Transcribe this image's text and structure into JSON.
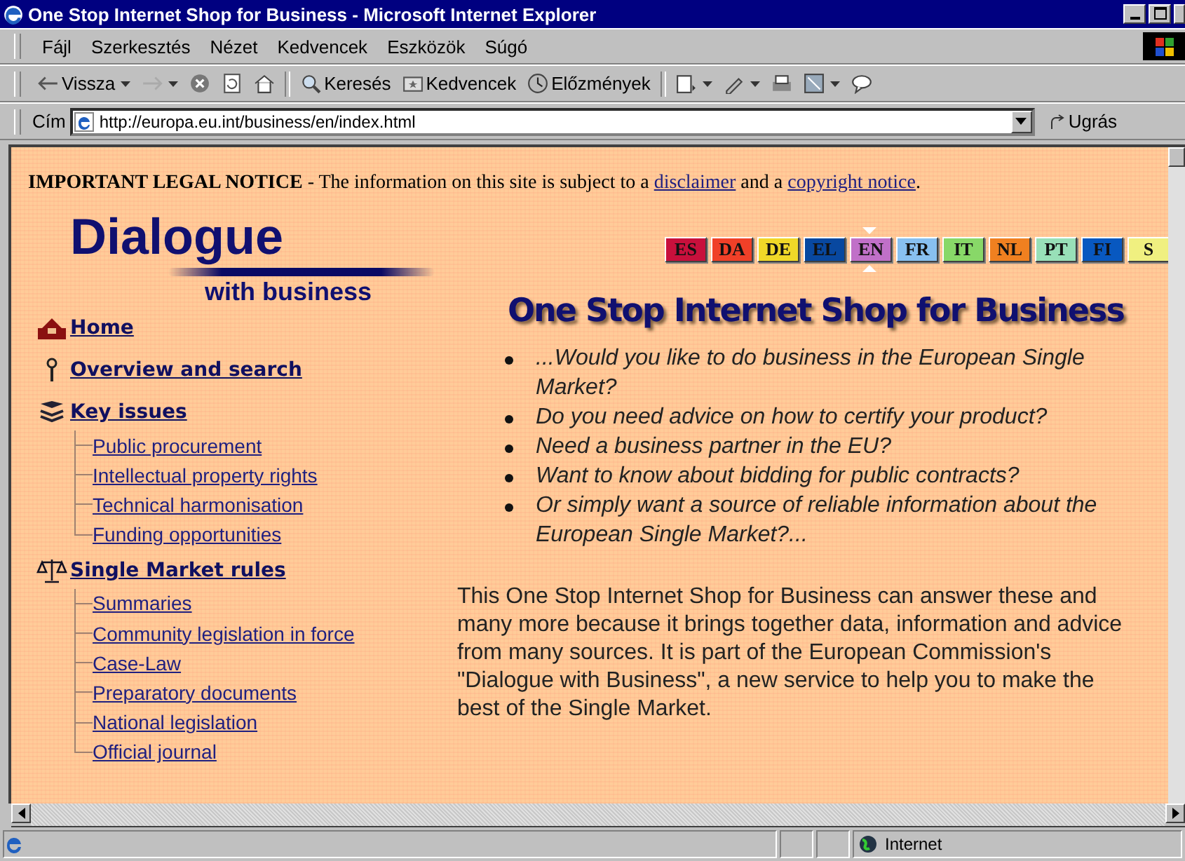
{
  "window": {
    "title": "One Stop Internet Shop for Business - Microsoft Internet Explorer"
  },
  "menu": [
    "Fájl",
    "Szerkesztés",
    "Nézet",
    "Kedvencek",
    "Eszközök",
    "Súgó"
  ],
  "toolbar": [
    {
      "kind": "back",
      "label": "Vissza"
    },
    {
      "kind": "forward"
    },
    {
      "kind": "stop"
    },
    {
      "kind": "refresh"
    },
    {
      "kind": "home"
    },
    {
      "kind": "search",
      "label": "Keresés"
    },
    {
      "kind": "favorites",
      "label": "Kedvencek"
    },
    {
      "kind": "history",
      "label": "Előzmények"
    },
    {
      "kind": "mail"
    },
    {
      "kind": "edit"
    },
    {
      "kind": "print"
    },
    {
      "kind": "discuss"
    },
    {
      "kind": "messenger"
    }
  ],
  "address": {
    "label": "Cím",
    "value": "http://europa.eu.int/business/en/index.html",
    "go": "Ugrás"
  },
  "notice": {
    "heading": "IMPORTANT LEGAL NOTICE",
    "text": " - The information on this site is subject to a ",
    "link1": "disclaimer",
    "mid": " and a ",
    "link2": "copyright notice",
    "end": "."
  },
  "logo": {
    "title": "Dialogue",
    "subtitle": "with business"
  },
  "languages": [
    {
      "code": "ES",
      "color": "#c8103c",
      "selected": false
    },
    {
      "code": "DA",
      "color": "#f04028",
      "selected": false
    },
    {
      "code": "DE",
      "color": "#f0d828",
      "selected": false
    },
    {
      "code": "EL",
      "color": "#0848a0",
      "selected": false
    },
    {
      "code": "EN",
      "color": "#c070c8",
      "selected": true
    },
    {
      "code": "FR",
      "color": "#88c0f0",
      "selected": false
    },
    {
      "code": "IT",
      "color": "#88d868",
      "selected": false
    },
    {
      "code": "NL",
      "color": "#f08020",
      "selected": false
    },
    {
      "code": "PT",
      "color": "#98e0b8",
      "selected": false
    },
    {
      "code": "FI",
      "color": "#0858c0",
      "selected": false
    },
    {
      "code": "S",
      "color": "#f0f080",
      "selected": false
    }
  ],
  "nav": [
    {
      "kind": "home",
      "label": "Home"
    },
    {
      "kind": "pin",
      "label": "Overview and search"
    },
    {
      "kind": "books",
      "label": "Key issues",
      "children": [
        "Public procurement",
        "Intellectual property rights",
        "Technical harmonisation",
        "Funding opportunities"
      ]
    },
    {
      "kind": "scales",
      "label": "Single Market rules",
      "children": [
        "Summaries",
        "Community legislation in force",
        "Case-Law",
        "Preparatory documents",
        "National legislation",
        "Official journal"
      ]
    }
  ],
  "heading": "One Stop Internet Shop for Business",
  "questions": [
    "...Would you like to do business in the European Single Market?",
    "Do you need advice on how to certify your product?",
    "Need a business partner in the EU?",
    "Want to know about bidding for public contracts?",
    "Or simply want a source of reliable information about the European Single Market?..."
  ],
  "intro": "This One Stop Internet Shop for Business can answer these and many more because it brings together data, information and advice from many sources. It is part of the European Commission's \"Dialogue with Business\", a new service to help you to make the best of the Single Market.",
  "status": {
    "zone": "Internet"
  }
}
